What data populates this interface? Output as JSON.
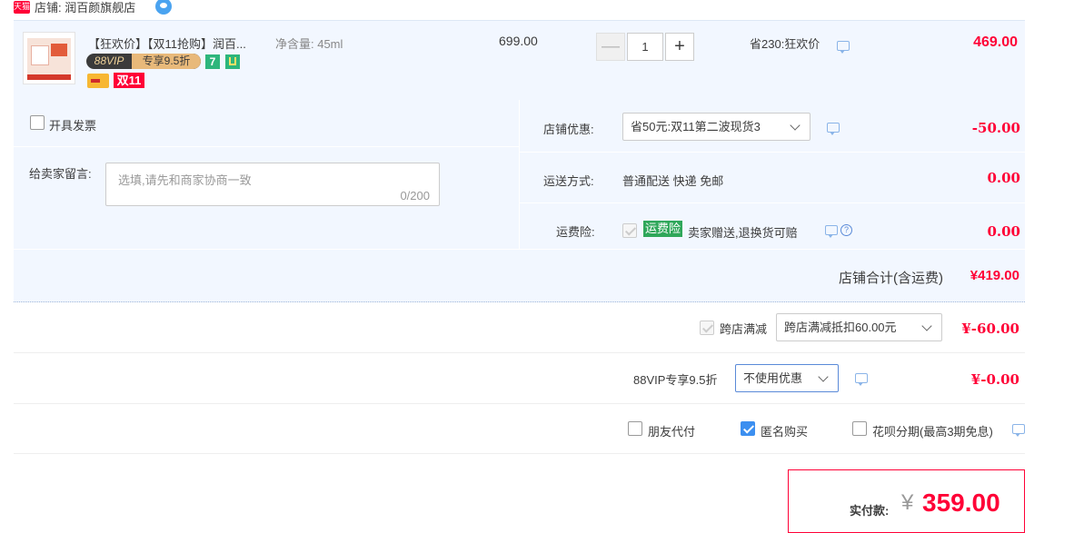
{
  "shop": {
    "badge": "天猫",
    "name": "店铺: 润百颜旗舰店"
  },
  "item": {
    "title": "【狂欢价】【双11抢购】润百...",
    "sku": "净含量: 45ml",
    "vip_badge_left": "88VIP",
    "vip_badge_right": "专享9.5折",
    "tag_seven": "7",
    "tag_double11": "双11",
    "unit_price": "699.00",
    "quantity": "1",
    "qty_minus": "—",
    "qty_plus": "+",
    "promo": "省230:狂欢价",
    "total": "469.00"
  },
  "invoice": {
    "label": "开具发票"
  },
  "message": {
    "label": "给卖家留言:",
    "placeholder": "选填,请先和商家协商一致",
    "counter": "0/200"
  },
  "store_discount": {
    "label": "店铺优惠:",
    "selected": "省50元:双11第二波现货3",
    "amount": "-50.00"
  },
  "shipping": {
    "label": "运送方式:",
    "value": "普通配送 快递 免邮",
    "amount": "0.00"
  },
  "insurance": {
    "label": "运费险:",
    "badge": "运费险",
    "text": "卖家赠送,退换货可赔",
    "help": "?",
    "amount": "0.00"
  },
  "store_total": {
    "label": "店铺合计(含运费)",
    "value": "¥419.00"
  },
  "cross_store": {
    "label": "跨店满减",
    "selected": "跨店满减抵扣60.00元",
    "amount": "¥-60.00"
  },
  "vip_discount": {
    "label": "88VIP专享9.5折",
    "selected": "不使用优惠",
    "amount": "¥-0.00"
  },
  "options": {
    "friend_pay": "朋友代付",
    "anonymous": "匿名购买",
    "installment": "花呗分期(最高3期免息)"
  },
  "payment": {
    "label": "实付款:",
    "currency": "¥",
    "amount": "359.00"
  },
  "colors": {
    "accent_red": "#ff0036",
    "row_bg": "#f2f7ff",
    "checkbox_blue": "#3c8ff0",
    "insurance_green": "#2fa75a"
  }
}
